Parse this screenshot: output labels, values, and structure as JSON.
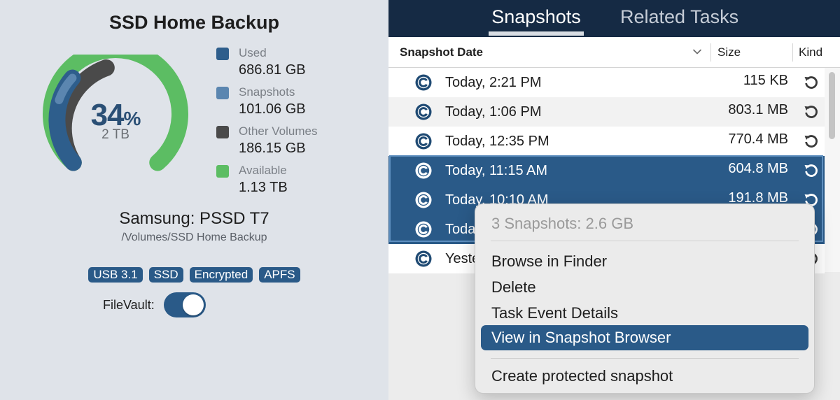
{
  "volume": {
    "title": "SSD Home Backup",
    "usage_percent_number": "34",
    "usage_percent_sign": "%",
    "capacity": "2 TB",
    "device_name": "Samsung: PSSD T7",
    "mount_path": "/Volumes/SSD Home Backup",
    "tags": [
      "USB 3.1",
      "SSD",
      "Encrypted",
      "APFS"
    ],
    "filevault_label": "FileVault:",
    "filevault_on": true,
    "gauge_fractions": {
      "used": 0.34,
      "snapshots": 0.05,
      "other_volumes": 0.09,
      "available": 0.52
    }
  },
  "legend": [
    {
      "label": "Used",
      "value": "686.81 GB",
      "color": "#2e5e8c"
    },
    {
      "label": "Snapshots",
      "value": "101.06 GB",
      "color": "#5b86b0"
    },
    {
      "label": "Other Volumes",
      "value": "186.15 GB",
      "color": "#4a4a4a"
    },
    {
      "label": "Available",
      "value": "1.13 TB",
      "color": "#5cbd63"
    }
  ],
  "tabs": {
    "snapshots": "Snapshots",
    "related_tasks": "Related Tasks"
  },
  "table": {
    "columns": {
      "date": "Snapshot Date",
      "size": "Size",
      "kind": "Kind"
    },
    "rows": [
      {
        "date": "Today, 2:21 PM",
        "size": "115 KB",
        "selected": false
      },
      {
        "date": "Today, 1:06 PM",
        "size": "803.1 MB",
        "selected": false
      },
      {
        "date": "Today, 12:35 PM",
        "size": "770.4 MB",
        "selected": false
      },
      {
        "date": "Today, 11:15 AM",
        "size": "604.8 MB",
        "selected": true
      },
      {
        "date": "Today, 10:10 AM",
        "size": "191.8 MB",
        "selected": true
      },
      {
        "date": "Toda",
        "size": "",
        "selected": true
      },
      {
        "date": "Yeste",
        "size": "",
        "selected": false
      }
    ]
  },
  "context_menu": {
    "header": "3 Snapshots: 2.6 GB",
    "items": [
      "Browse in Finder",
      "Delete",
      "Task Event Details",
      "View in Snapshot Browser"
    ],
    "highlighted": "View in Snapshot Browser",
    "footer_item": "Create protected snapshot"
  },
  "colors": {
    "accent": "#2a5a88",
    "header_bg": "#152a44",
    "left_bg": "#dfe3e9",
    "available": "#5cbd63"
  }
}
